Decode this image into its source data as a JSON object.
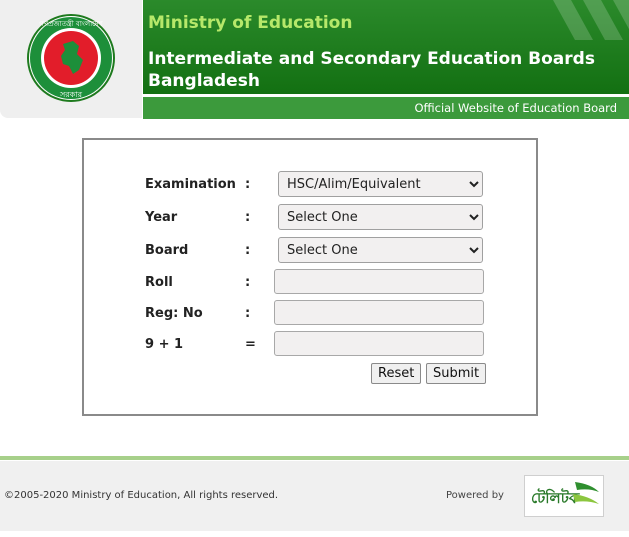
{
  "header": {
    "ministry": "Ministry of Education",
    "boards_line1": "Intermediate and Secondary Education Boards",
    "boards_line2": "Bangladesh",
    "official": "Official Website of Education Board",
    "logo_name": "government-seal-logo"
  },
  "form": {
    "examination": {
      "label": "Examination",
      "colon": ":",
      "value": "HSC/Alim/Equivalent"
    },
    "year": {
      "label": "Year",
      "colon": ":",
      "value": "Select One"
    },
    "board": {
      "label": "Board",
      "colon": ":",
      "value": "Select One"
    },
    "roll": {
      "label": "Roll",
      "colon": ":",
      "value": ""
    },
    "reg": {
      "label": "Reg: No",
      "colon": ":",
      "value": ""
    },
    "captcha": {
      "label": "9 + 1",
      "colon": "=",
      "value": ""
    },
    "reset_label": "Reset",
    "submit_label": "Submit"
  },
  "footer": {
    "copyright": "©2005-2020 Ministry of Education, All rights reserved.",
    "powered": "Powered by",
    "partner_logo": "টেলিটক"
  },
  "colors": {
    "green": "#137012",
    "accent": "#b6e86a",
    "flag_red": "#e21d2a"
  }
}
